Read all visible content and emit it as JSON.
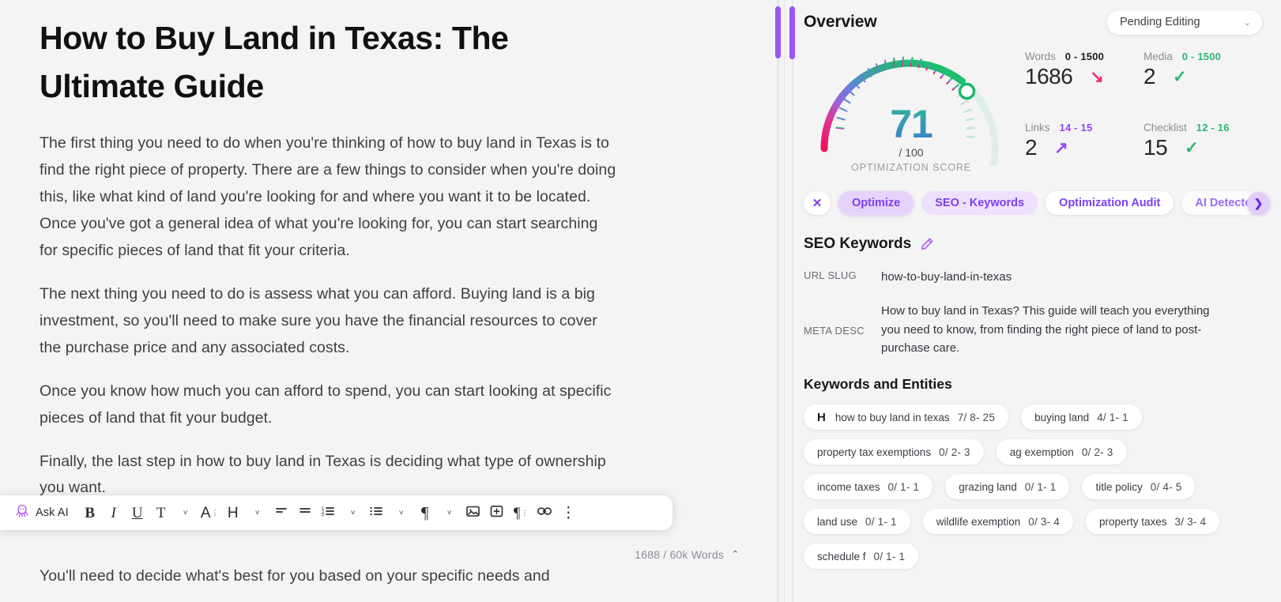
{
  "editor": {
    "title": "How to Buy Land in Texas: The Ultimate Guide",
    "paragraphs": [
      "The first thing you need to do when you're thinking of how to buy land in Texas is to find the right piece of property. There are a few things to consider when you're doing this, like what kind of land you're looking for and where you want it to be located. Once you've got a general idea of what you're looking for, you can start searching for specific pieces of land that fit your criteria.",
      "The next thing you need to do is assess what you can afford. Buying land is a big investment, so you'll need to make sure you have the financial resources to cover the purchase price and any associated costs.",
      "Once you know how much you can afford to spend, you can start looking at specific pieces of land that fit your budget.",
      "Finally, the last step in how to buy land in Texas is deciding what type of ownership you want.",
      "You'll need to decide what's best for you based on your specific needs and"
    ],
    "word_count": "1688 / 60k Words"
  },
  "toolbar": {
    "ask_ai_label": "Ask AI",
    "bold_label": "B",
    "italic_label": "I",
    "underline_label": "U",
    "text_style_label": "T",
    "font_color_label": "A",
    "heading_label": "H",
    "align_left_label": "≡",
    "align_center_label": "≡",
    "ordered_list_label": "≣",
    "bullet_list_label": "≣",
    "paragraph_label": "¶",
    "image_label": "▣",
    "insert_label": "+",
    "pilcrow_label": "¶",
    "link_label": "🔗",
    "more_label": "⋮",
    "caret": "˅"
  },
  "overview": {
    "title": "Overview",
    "status": "Pending Editing",
    "gauge": {
      "score": "71",
      "out_of": "/ 100",
      "label": "OPTIMIZATION SCORE",
      "value": 71,
      "max": 100
    },
    "metrics": [
      {
        "name": "Words",
        "range": "0 - 1500",
        "range_color": "#1b1b20",
        "value": "1686",
        "indicator": "↘",
        "indicator_color": "#f0286e"
      },
      {
        "name": "Media",
        "range": "0 - 1500",
        "range_color": "#2bb673",
        "value": "2",
        "indicator": "✓",
        "indicator_color": "#2bb673"
      },
      {
        "name": "Links",
        "range": "14 - 15",
        "range_color": "#9147f0",
        "value": "2",
        "indicator": "↗",
        "indicator_color": "#9147f0"
      },
      {
        "name": "Checklist",
        "range": "12 - 16",
        "range_color": "#2bb673",
        "value": "15",
        "indicator": "✓",
        "indicator_color": "#2bb673"
      }
    ]
  },
  "tabs": {
    "close_label": "✕",
    "next_label": "❯",
    "items": [
      {
        "label": "Optimize",
        "state": "sel-strong"
      },
      {
        "label": "SEO - Keywords",
        "state": "sel-soft"
      },
      {
        "label": "Optimization Audit",
        "state": "plain"
      },
      {
        "label": "AI Detector",
        "state": "cut"
      }
    ]
  },
  "seo": {
    "heading": "SEO Keywords",
    "url_slug_label": "URL SLUG",
    "url_slug_value": "how-to-buy-land-in-texas",
    "meta_desc_label": "META DESC",
    "meta_desc_value": "How to buy land in Texas? This guide will teach you everything you need to know, from finding the right piece of land to post-purchase care.",
    "entities_heading": "Keywords and Entities",
    "chips": [
      {
        "badge": "H",
        "text": "how to buy land in texas",
        "num": "7/ 8- 25"
      },
      {
        "badge": "",
        "text": "buying land",
        "num": "4/ 1- 1"
      },
      {
        "badge": "",
        "text": "property tax exemptions",
        "num": "0/ 2- 3"
      },
      {
        "badge": "",
        "text": "ag exemption",
        "num": "0/ 2- 3"
      },
      {
        "badge": "",
        "text": "income taxes",
        "num": "0/ 1- 1"
      },
      {
        "badge": "",
        "text": "grazing land",
        "num": "0/ 1- 1"
      },
      {
        "badge": "",
        "text": "title policy",
        "num": "0/ 4- 5"
      },
      {
        "badge": "",
        "text": "land use",
        "num": "0/ 1- 1"
      },
      {
        "badge": "",
        "text": "wildlife exemption",
        "num": "0/ 3- 4"
      },
      {
        "badge": "",
        "text": "property taxes",
        "num": "3/ 3- 4"
      },
      {
        "badge": "",
        "text": "schedule f",
        "num": "0/ 1- 1"
      }
    ]
  },
  "colors": {
    "accent_purple": "#7d3ff2",
    "scroll_thumb": "#9a55f7",
    "green": "#2bb673",
    "pink": "#f0286e",
    "panel_bg": "#f4f4f5"
  }
}
